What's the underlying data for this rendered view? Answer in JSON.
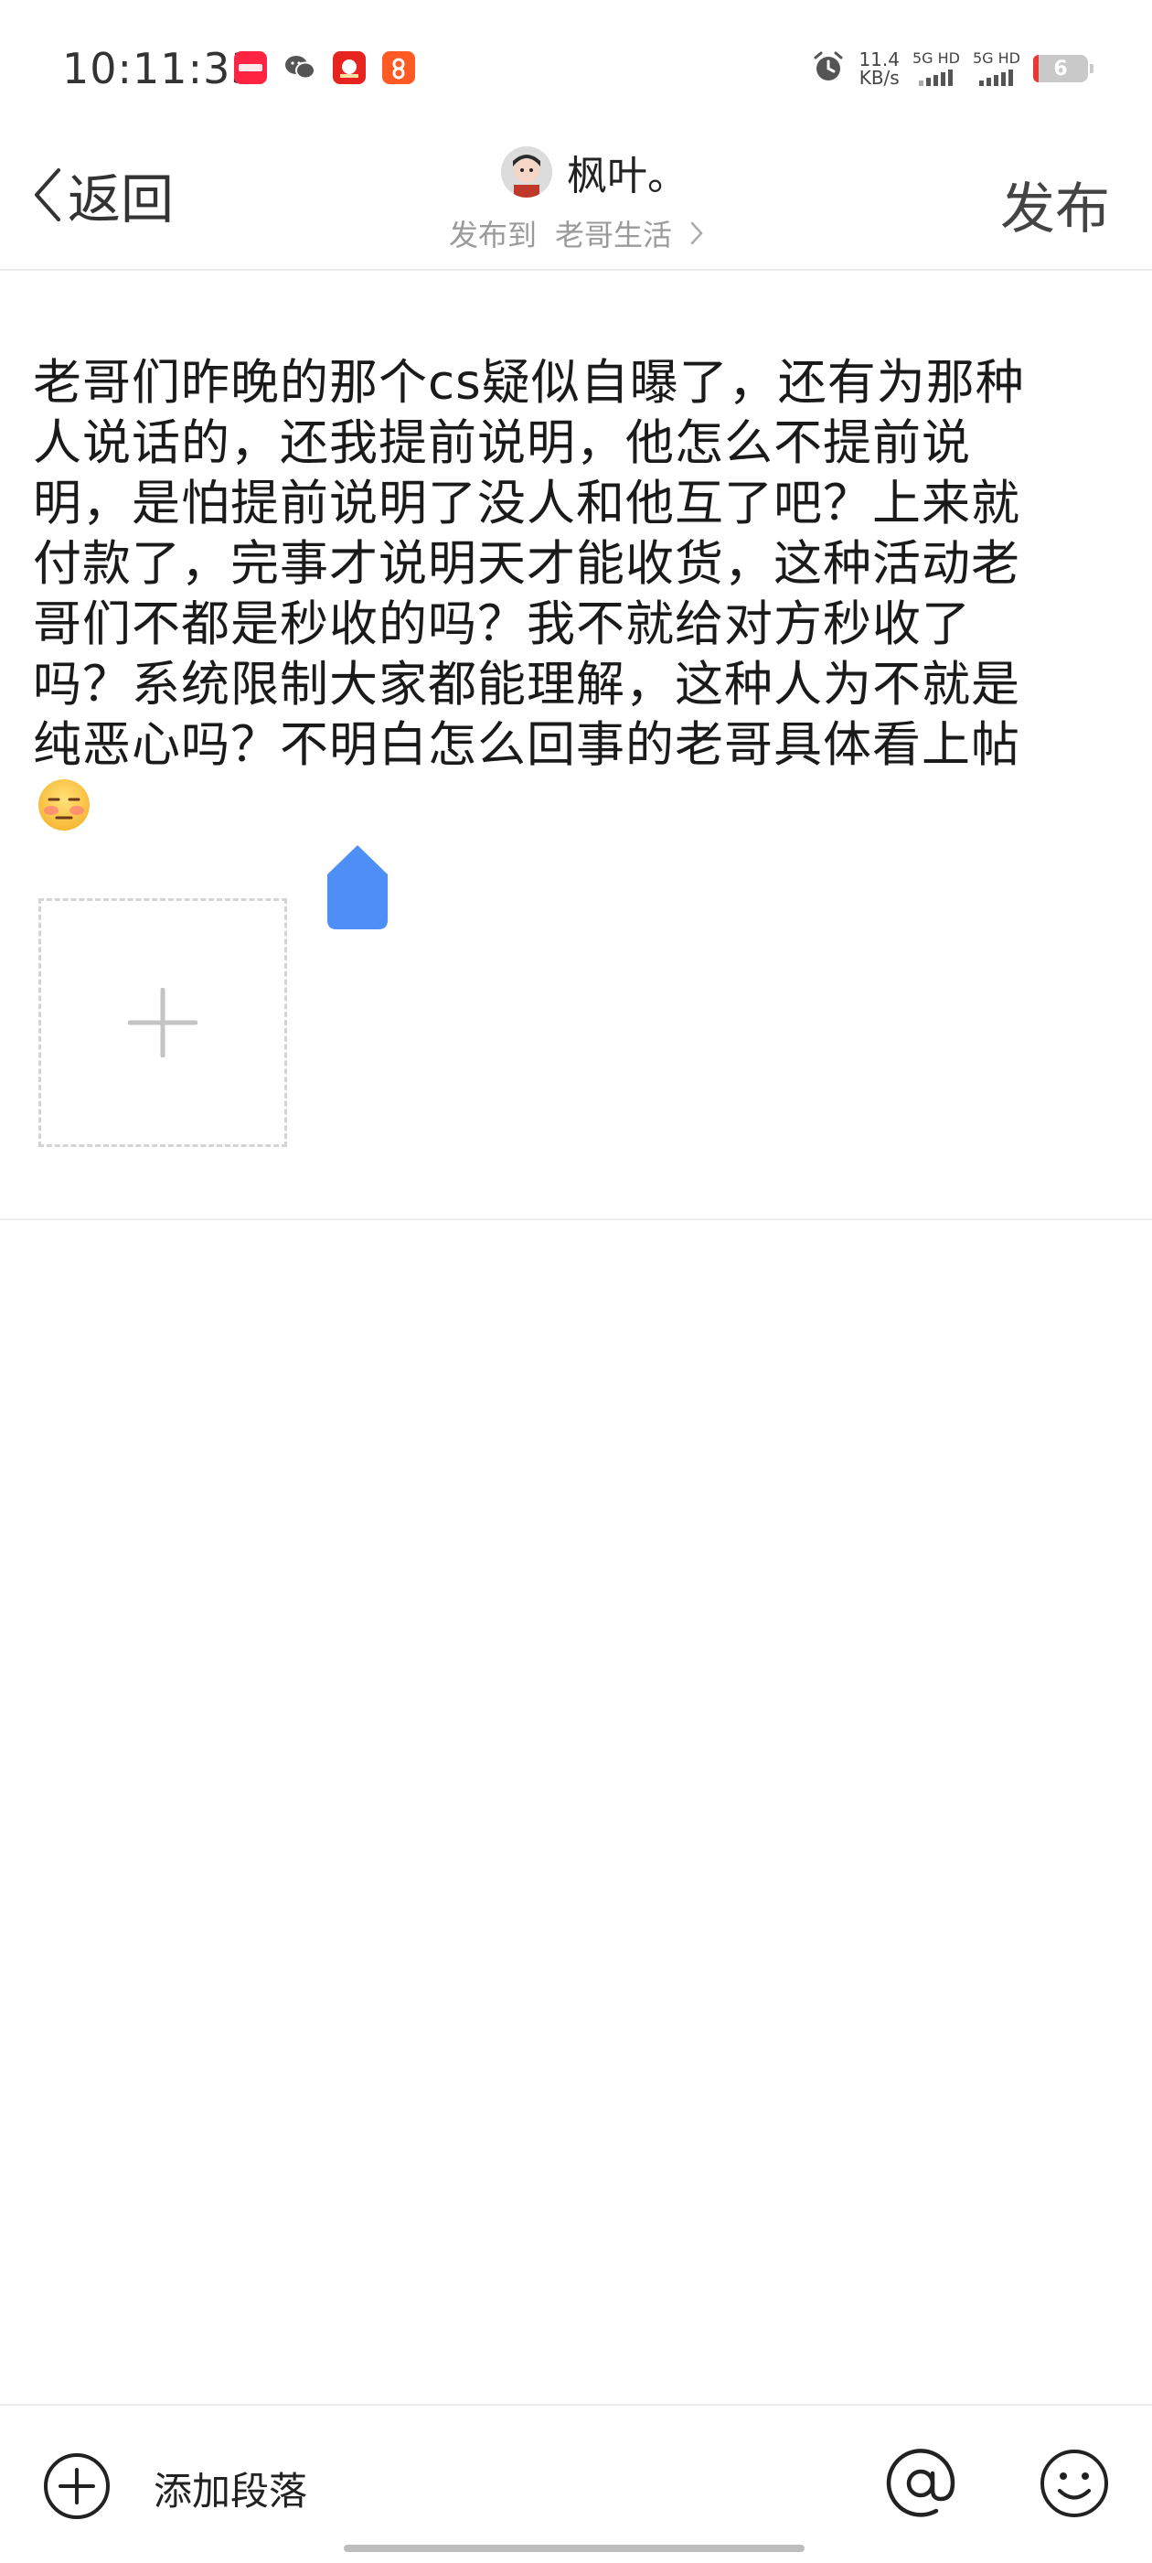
{
  "status_bar": {
    "time": "10:11:33",
    "notifications": [
      "xiaohongshu-icon",
      "wechat-icon",
      "taobao-icon",
      "app-icon"
    ],
    "net_speed_value": "11.4",
    "net_speed_unit": "KB/s",
    "sim1": "5G HD",
    "sim2": "5G HD",
    "battery": "6"
  },
  "header": {
    "back_label": "返回",
    "author_name": "枫叶。",
    "publish_to_label": "发布到",
    "board_name": "老哥生活",
    "publish_label": "发布"
  },
  "post": {
    "body": "老哥们昨晚的那个cs疑似自曝了，还有为那种人说话的，还我提前说明，他怎么不提前说明，是怕提前说明了没人和他互了吧？上来就付款了，完事才说明天才能收货，这种活动老哥们不都是秒收的吗？我不就给对方秒收了吗？系统限制大家都能理解，这种人为不就是纯恶心吗？不明白怎么回事的老哥具体看上帖",
    "trailing_emoji": "flushed-face-emoji"
  },
  "toolbar": {
    "add_paragraph_label": "添加段落"
  },
  "colors": {
    "accent_blue": "#4d8ef7",
    "text": "#1a1a1a",
    "muted": "#9a9a9a"
  }
}
